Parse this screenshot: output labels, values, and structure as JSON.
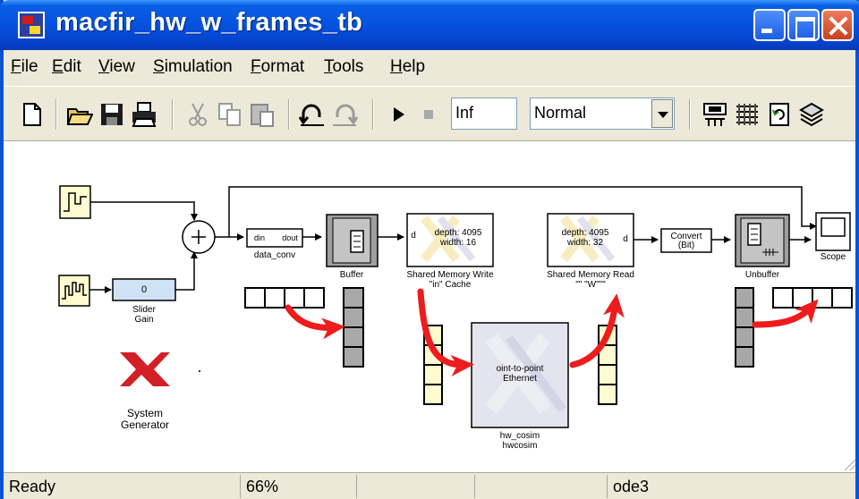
{
  "window": {
    "title": "macfir_hw_w_frames_tb"
  },
  "menu": [
    "File",
    "Edit",
    "View",
    "Simulation",
    "Format",
    "Tools",
    "Help"
  ],
  "toolbar": {
    "stop_time": "Inf",
    "sim_mode": "Normal",
    "icons": [
      "new-icon",
      "open-icon",
      "save-icon",
      "print-icon",
      "cut-icon",
      "copy-icon",
      "paste-icon",
      "undo-icon",
      "redo-icon",
      "start-icon",
      "stop-icon",
      "build-icon",
      "library-icon",
      "update-icon",
      "debug-icon"
    ]
  },
  "diagram": {
    "blocks": {
      "slider_value": "0",
      "slider_label_1": "Slider",
      "slider_label_2": "Gain",
      "data_conv_in": "din",
      "data_conv_out": "dout",
      "data_conv": "data_conv",
      "buffer": "Buffer",
      "smw_depth": "depth: 4095",
      "smw_width": "width: 16",
      "smw_port": "d",
      "smw_label_1": "Shared Memory Write",
      "smw_label_2": "\"in\" Cache",
      "smr_depth": "depth: 4095",
      "smr_width": "width: 32",
      "smr_port": "d",
      "smr_label_1": "Shared Memory Read",
      "smr_label_2": "\"\" \"W\"\"\"",
      "convert_1": "Convert",
      "convert_2": "(Bit)",
      "unbuffer": "Unbuffer",
      "scope": "Scope",
      "cosim_1": "oint-to-point",
      "cosim_2": "Ethernet",
      "hw_cosim_1": "hw_cosim",
      "hw_cosim_2": "hwcosim",
      "sysgen_1": "System",
      "sysgen_2": "Generator"
    }
  },
  "status": {
    "state": "Ready",
    "zoom": "66%",
    "pane3": "",
    "pane4": "",
    "solver": "ode3"
  }
}
